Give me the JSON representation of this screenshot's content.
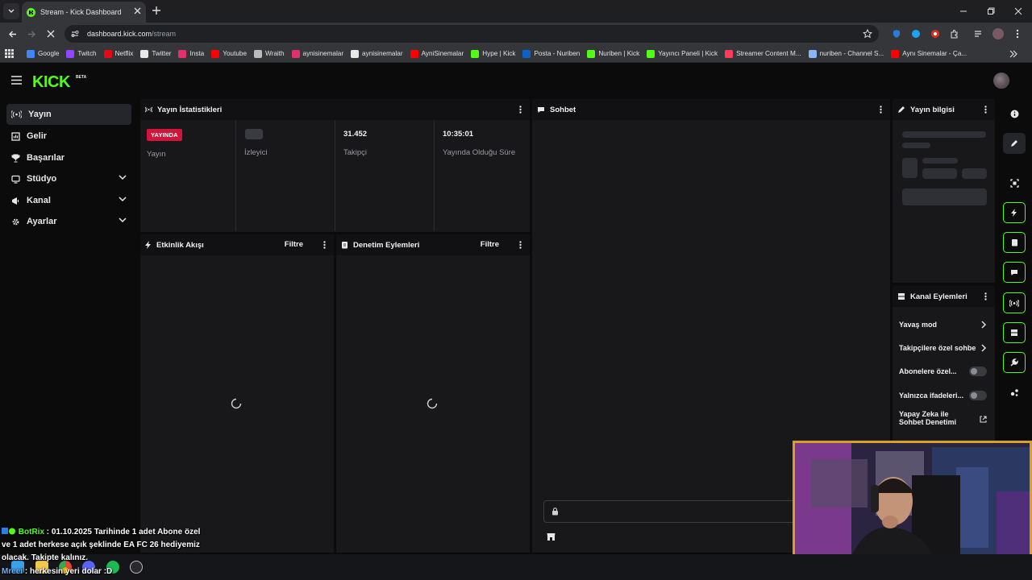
{
  "browser": {
    "tab_title": "Stream - Kick Dashboard",
    "url_host": "dashboard.kick.com",
    "url_path": "/stream",
    "bookmarks": [
      {
        "label": "Google",
        "icon": "google-icon",
        "color": "#4285f4"
      },
      {
        "label": "Twitch",
        "icon": "twitch-icon",
        "color": "#9146ff"
      },
      {
        "label": "Netflix",
        "icon": "netflix-icon",
        "color": "#e50914"
      },
      {
        "label": "Twitter",
        "icon": "x-icon",
        "color": "#e8e8e8"
      },
      {
        "label": "Insta",
        "icon": "instagram-icon",
        "color": "#e1306c"
      },
      {
        "label": "Youtube",
        "icon": "youtube-icon",
        "color": "#ff0000"
      },
      {
        "label": "Wraith",
        "icon": "wraith-icon",
        "color": "#bbbbbb"
      },
      {
        "label": "aynisinemalar",
        "icon": "instagram-icon",
        "color": "#e1306c"
      },
      {
        "label": "aynisinemalar",
        "icon": "x-icon",
        "color": "#e8e8e8"
      },
      {
        "label": "AyniSinemalar",
        "icon": "youtube-icon",
        "color": "#ff0000"
      },
      {
        "label": "Hype | Kick",
        "icon": "kick-icon",
        "color": "#53fc18"
      },
      {
        "label": "Posta - Nuriben",
        "icon": "outlook-icon",
        "color": "#0a64c8"
      },
      {
        "label": "Nuriben | Kick",
        "icon": "kick-icon",
        "color": "#53fc18"
      },
      {
        "label": "Yayıncı Paneli | Kick",
        "icon": "kick-icon",
        "color": "#53fc18"
      },
      {
        "label": "Streamer Content M...",
        "icon": "streamer-icon",
        "color": "#ff3b5c"
      },
      {
        "label": "nuriben - Channel S...",
        "icon": "channel-icon",
        "color": "#8ab4f8"
      },
      {
        "label": "Aynı Sinemalar - Ça...",
        "icon": "youtube-icon",
        "color": "#ff0000"
      }
    ]
  },
  "kick": {
    "logo_text": "KICK",
    "logo_badge": "BETA",
    "brand_color": "#53fc18"
  },
  "sidebar": {
    "items": [
      {
        "label": "Yayın",
        "icon": "broadcast-icon",
        "active": true
      },
      {
        "label": "Gelir",
        "icon": "revenue-icon"
      },
      {
        "label": "Başarılar",
        "icon": "trophy-icon"
      },
      {
        "label": "Stüdyo",
        "icon": "studio-icon",
        "expandable": true
      },
      {
        "label": "Kanal",
        "icon": "channel-icon",
        "expandable": true
      },
      {
        "label": "Ayarlar",
        "icon": "gear-icon",
        "expandable": true
      }
    ]
  },
  "stats_panel": {
    "title": "Yayın İstatistikleri",
    "live_badge": "YAYINDA",
    "live_color": "#d2143a",
    "cells": [
      {
        "label": "Yayın"
      },
      {
        "label": "İzleyici"
      },
      {
        "value": "31.452",
        "label": "Takipçi"
      },
      {
        "value": "10:35:01",
        "label": "Yayında Olduğu Süre"
      }
    ]
  },
  "activity_panel": {
    "title": "Etkinlik Akışı",
    "filter": "Filtre"
  },
  "moderation_panel": {
    "title": "Denetim Eylemleri",
    "filter": "Filtre"
  },
  "chat_panel": {
    "title": "Sohbet"
  },
  "stream_info_panel": {
    "title": "Yayın bilgisi"
  },
  "channel_actions_panel": {
    "title": "Kanal Eylemleri",
    "rows": [
      {
        "label": "Yavaş mod",
        "control": "chevron"
      },
      {
        "label": "Takipçilere özel sohbe",
        "control": "chevron"
      },
      {
        "label": "Abonelere özel...",
        "control": "toggle"
      },
      {
        "label": "Yalnızca ifadeleri...",
        "control": "toggle"
      },
      {
        "label": "Yapay Zeka ile",
        "label2": "Sohbet Denetimi",
        "control": "external"
      }
    ]
  },
  "chat_overlay": {
    "line1_user": "BotRix",
    "line1_text": " : 01.10.2025 Tarihinde 1 adet Abone özel",
    "line2_text": "ve 1 adet herkese açık şeklinde EA FC 26 hediyemiz",
    "line3_text": "olacak. Takipte kalınız.",
    "line4_user": "Mreei",
    "line4_text": " : herkesin yeri dolar :D"
  }
}
